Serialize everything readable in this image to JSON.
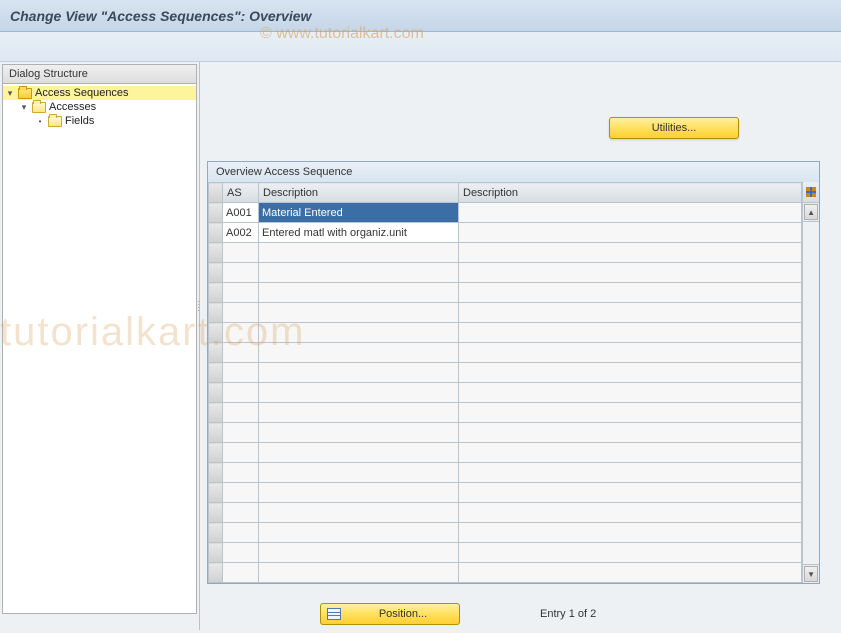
{
  "header": {
    "title": "Change View \"Access Sequences\": Overview"
  },
  "watermark": {
    "top": "© www.tutorialkart.com",
    "big": "tutorialkart.com"
  },
  "sidebar": {
    "header": "Dialog Structure",
    "tree": {
      "root": "Access Sequences",
      "child1": "Accesses",
      "child2": "Fields"
    }
  },
  "buttons": {
    "utilities": "Utilities...",
    "position": "Position..."
  },
  "grid": {
    "title": "Overview Access Sequence",
    "headers": {
      "as": "AS",
      "desc1": "Description",
      "desc2": "Description"
    },
    "rows": [
      {
        "as": "A001",
        "desc1": "Material Entered",
        "desc2": ""
      },
      {
        "as": "A002",
        "desc1": "Entered matl with organiz.unit",
        "desc2": ""
      }
    ]
  },
  "status": {
    "entry_text": "Entry 1 of 2"
  }
}
